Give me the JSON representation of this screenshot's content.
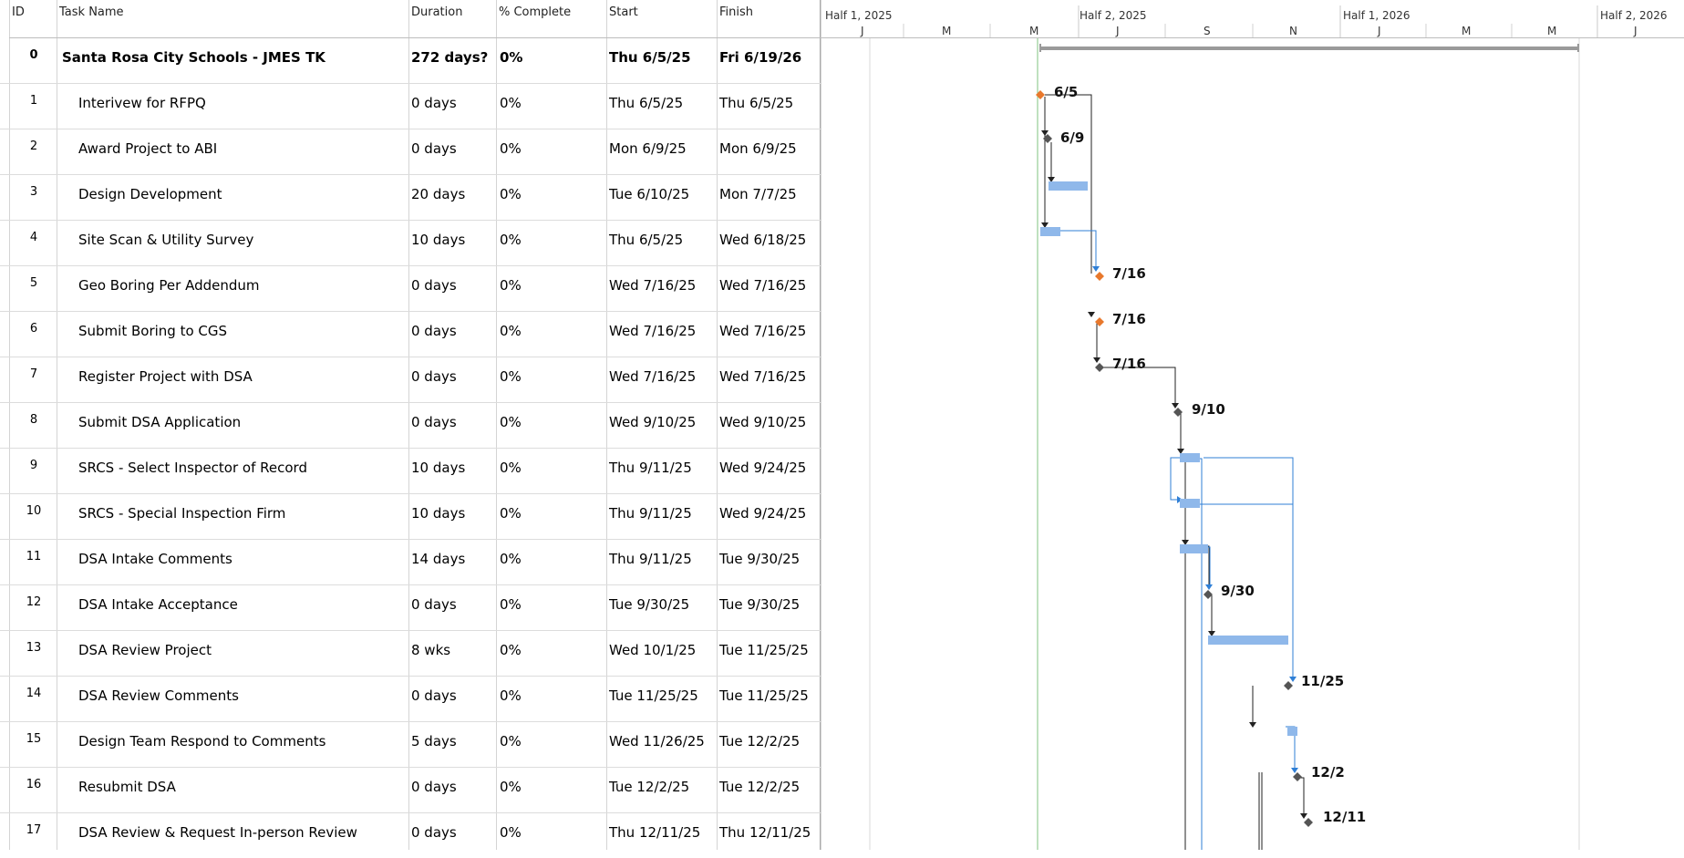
{
  "columns": {
    "id": "ID",
    "name": "Task Name",
    "duration": "Duration",
    "pct": "% Complete",
    "start": "Start",
    "finish": "Finish"
  },
  "timescale": {
    "top": [
      "Half 1, 2025",
      "Half 2, 2025",
      "Half 1, 2026",
      "Half 2, 2026"
    ],
    "bottom": [
      "J",
      "M",
      "M",
      "J",
      "S",
      "N",
      "J",
      "M",
      "M",
      "J"
    ]
  },
  "tasks": [
    {
      "id": "0",
      "name": "Santa Rosa City Schools - JMES TK",
      "duration": "272 days?",
      "pct": "0%",
      "start": "Thu 6/5/25",
      "finish": "Fri 6/19/26"
    },
    {
      "id": "1",
      "name": "Interivew for RFPQ",
      "duration": "0 days",
      "pct": "0%",
      "start": "Thu 6/5/25",
      "finish": "Thu 6/5/25"
    },
    {
      "id": "2",
      "name": "Award Project to ABI",
      "duration": "0 days",
      "pct": "0%",
      "start": "Mon 6/9/25",
      "finish": "Mon 6/9/25"
    },
    {
      "id": "3",
      "name": "Design Development",
      "duration": "20 days",
      "pct": "0%",
      "start": "Tue 6/10/25",
      "finish": "Mon 7/7/25"
    },
    {
      "id": "4",
      "name": "Site Scan & Utility Survey",
      "duration": "10 days",
      "pct": "0%",
      "start": "Thu 6/5/25",
      "finish": "Wed 6/18/25"
    },
    {
      "id": "5",
      "name": "Geo Boring Per Addendum",
      "duration": "0 days",
      "pct": "0%",
      "start": "Wed 7/16/25",
      "finish": "Wed 7/16/25"
    },
    {
      "id": "6",
      "name": "Submit Boring to CGS",
      "duration": "0 days",
      "pct": "0%",
      "start": "Wed 7/16/25",
      "finish": "Wed 7/16/25"
    },
    {
      "id": "7",
      "name": "Register Project with DSA",
      "duration": "0 days",
      "pct": "0%",
      "start": "Wed 7/16/25",
      "finish": "Wed 7/16/25"
    },
    {
      "id": "8",
      "name": "Submit DSA Application",
      "duration": "0 days",
      "pct": "0%",
      "start": "Wed 9/10/25",
      "finish": "Wed 9/10/25"
    },
    {
      "id": "9",
      "name": "SRCS - Select Inspector of Record",
      "duration": "10 days",
      "pct": "0%",
      "start": "Thu 9/11/25",
      "finish": "Wed 9/24/25"
    },
    {
      "id": "10",
      "name": "SRCS - Special Inspection Firm",
      "duration": "10 days",
      "pct": "0%",
      "start": "Thu 9/11/25",
      "finish": "Wed 9/24/25"
    },
    {
      "id": "11",
      "name": "DSA Intake Comments",
      "duration": "14 days",
      "pct": "0%",
      "start": "Thu 9/11/25",
      "finish": "Tue 9/30/25"
    },
    {
      "id": "12",
      "name": "DSA Intake Acceptance",
      "duration": "0 days",
      "pct": "0%",
      "start": "Tue 9/30/25",
      "finish": "Tue 9/30/25"
    },
    {
      "id": "13",
      "name": "DSA Review Project",
      "duration": "8 wks",
      "pct": "0%",
      "start": "Wed 10/1/25",
      "finish": "Tue 11/25/25"
    },
    {
      "id": "14",
      "name": "DSA Review Comments",
      "duration": "0 days",
      "pct": "0%",
      "start": "Tue 11/25/25",
      "finish": "Tue 11/25/25"
    },
    {
      "id": "15",
      "name": "Design Team Respond to Comments",
      "duration": "5 days",
      "pct": "0%",
      "start": "Wed 11/26/25",
      "finish": "Tue 12/2/25"
    },
    {
      "id": "16",
      "name": "Resubmit DSA",
      "duration": "0 days",
      "pct": "0%",
      "start": "Tue 12/2/25",
      "finish": "Tue 12/2/25"
    },
    {
      "id": "17",
      "name": "DSA Review & Request In-person Review",
      "duration": "0 days",
      "pct": "0%",
      "start": "Thu 12/11/25",
      "finish": "Thu 12/11/25"
    }
  ],
  "milestone_labels": {
    "m1": "6/5",
    "m2": "6/9",
    "m5": "7/16",
    "m6": "7/16",
    "m7": "7/16",
    "m8": "9/10",
    "m12": "9/30",
    "m14": "11/25",
    "m16": "12/2",
    "m17": "12/11"
  },
  "colors": {
    "bar": "#8fb8ea",
    "bar_blue_link": "#2f7fd6",
    "milestone_critical": "#e8782c",
    "milestone": "#555555",
    "summary_bar": "#9a9a9a",
    "today_line": "#7fc37f"
  }
}
